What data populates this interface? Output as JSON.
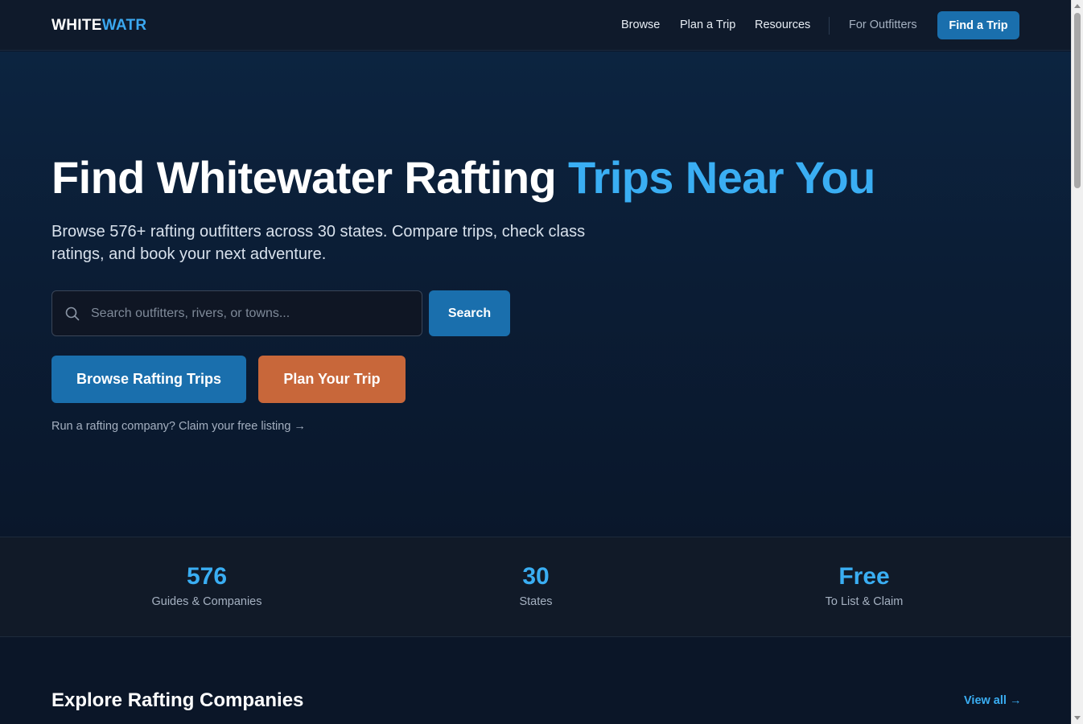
{
  "nav": {
    "logo_part1": "WHITE",
    "logo_part2": "WATR",
    "links": [
      "Browse",
      "Plan a Trip",
      "Resources"
    ],
    "for_outfitters": "For Outfitters",
    "cta": "Find a Trip"
  },
  "hero": {
    "title_main": "Find Whitewater Rafting",
    "title_accent": "Trips Near You",
    "subtitle": "Browse 576+ rafting outfitters across 30 states. Compare trips, check class ratings, and book your next adventure.",
    "search_placeholder": "Search outfitters, rivers, or towns...",
    "search_value": "",
    "search_button": "Search",
    "browse_button": "Browse Rafting Trips",
    "plan_button": "Plan Your Trip",
    "claim_link": "Run a rafting company? Claim your free listing →"
  },
  "stats": [
    {
      "value": "576",
      "label": "Guides & Companies"
    },
    {
      "value": "30",
      "label": "States"
    },
    {
      "value": "Free",
      "label": "To List & Claim"
    }
  ],
  "section": {
    "title": "Explore Rafting Companies",
    "view_all": "View all →"
  },
  "colors": {
    "accent": "#3aaef3",
    "primary_button": "#1a6fad",
    "plan_button": "#c8673a",
    "background": "#0b1628"
  }
}
